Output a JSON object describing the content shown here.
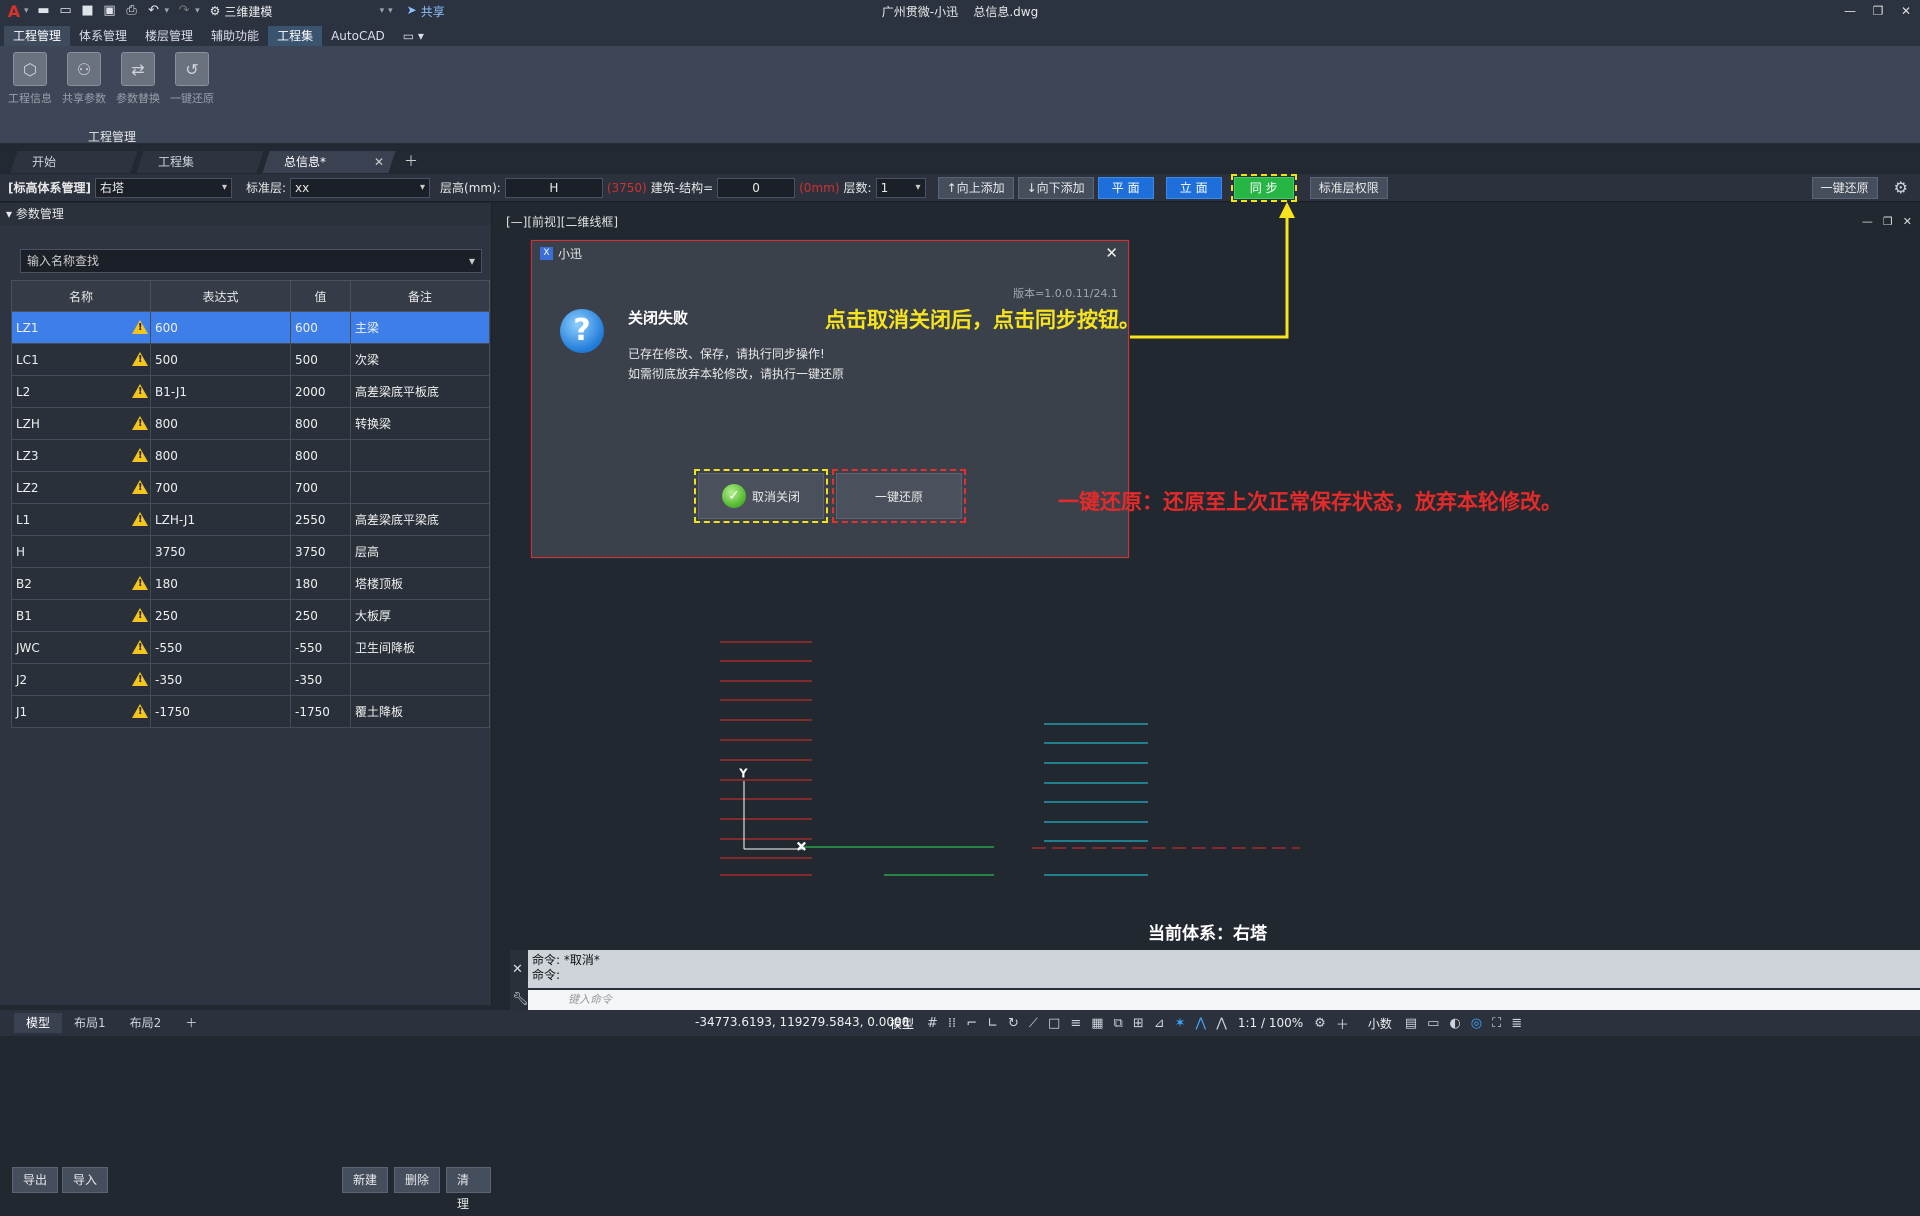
{
  "titlebar": {
    "workspace": "三维建模",
    "share": "共享",
    "app_name": "广州贯微-小迅",
    "file_name": "总信息.dwg"
  },
  "ribbon_tabs": [
    "工程管理",
    "体系管理",
    "楼层管理",
    "辅助功能",
    "工程集",
    "AutoCAD"
  ],
  "ribbon": {
    "buttons": [
      "工程信息",
      "共享参数",
      "参数替换",
      "一键还原"
    ],
    "panel_label": "工程管理"
  },
  "doc_tabs": [
    "开始",
    "工程集",
    "总信息*"
  ],
  "toolbar": {
    "system_label": "[标高体系管理]",
    "system_value": "右塔",
    "std_floor_label": "标准层:",
    "std_floor_value": "xx",
    "height_label": "层高(mm):",
    "height_value": "H",
    "height_red": "(3750)",
    "arch_label": "建筑-结构=",
    "arch_value": "0",
    "arch_red": "(0mm)",
    "floors_label": "层数:",
    "floors_value": "1",
    "add_up": "↑向上添加",
    "add_down": "↓向下添加",
    "plan": "平  面",
    "elev": "立  面",
    "sync": "同  步",
    "perm": "标准层权限",
    "restore": "一键还原"
  },
  "left_panel": {
    "title": "参数管理",
    "search_placeholder": "输入名称查找",
    "columns": [
      "名称",
      "表达式",
      "值",
      "备注"
    ],
    "rows": [
      {
        "name": "LZ1",
        "expr": "600",
        "value": "600",
        "note": "主梁",
        "warn": true,
        "selected": true
      },
      {
        "name": "LC1",
        "expr": "500",
        "value": "500",
        "note": "次梁",
        "warn": true
      },
      {
        "name": "L2",
        "expr": "B1-J1",
        "value": "2000",
        "note": "高差梁底平板底",
        "warn": true
      },
      {
        "name": "LZH",
        "expr": "800",
        "value": "800",
        "note": "转换梁",
        "warn": true
      },
      {
        "name": "LZ3",
        "expr": "800",
        "value": "800",
        "note": "",
        "warn": true
      },
      {
        "name": "LZ2",
        "expr": "700",
        "value": "700",
        "note": "",
        "warn": true
      },
      {
        "name": "L1",
        "expr": "LZH-J1",
        "value": "2550",
        "note": "高差梁底平梁底",
        "warn": true
      },
      {
        "name": "H",
        "expr": "3750",
        "value": "3750",
        "note": "层高",
        "warn": false
      },
      {
        "name": "B2",
        "expr": "180",
        "value": "180",
        "note": "塔楼顶板",
        "warn": true
      },
      {
        "name": "B1",
        "expr": "250",
        "value": "250",
        "note": "大板厚",
        "warn": true
      },
      {
        "name": "JWC",
        "expr": "-550",
        "value": "-550",
        "note": "卫生间降板",
        "warn": true
      },
      {
        "name": "J2",
        "expr": "-350",
        "value": "-350",
        "note": "",
        "warn": true
      },
      {
        "name": "J1",
        "expr": "-1750",
        "value": "-1750",
        "note": "覆土降板",
        "warn": true
      }
    ],
    "buttons": {
      "export": "导出",
      "import": "导入",
      "new": "新建",
      "delete": "删除",
      "clear": "清理"
    }
  },
  "viewport": {
    "label": "[—][前视][二维线框]",
    "current_system": "当前体系：右塔"
  },
  "dialog": {
    "title": "小迅",
    "version": "版本=1.0.0.11/24.1",
    "heading": "关闭失败",
    "line1": "已存在修改、保存，请执行同步操作!",
    "line2": "如需彻底放弃本轮修改，请执行一键还原",
    "cancel_close": "取消关闭",
    "restore": "一键还原"
  },
  "annotations": {
    "yellow": "点击取消关闭后，点击同步按钮。",
    "red": "一键还原：还原至上次正常保存状态，放弃本轮修改。"
  },
  "command": {
    "line1": "命令: *取消*",
    "line2": "命令:",
    "input_placeholder": "键入命令"
  },
  "status": {
    "tabs": [
      "模型",
      "布局1",
      "布局2"
    ],
    "coords": "-34773.6193, 119279.5843, 0.0000",
    "model": "模型",
    "scale": "1:1 / 100%",
    "units": "小数"
  },
  "colors": {
    "accent_blue": "#1e6fd9",
    "sync_green": "#27b545",
    "annot_yellow": "#f7e41d",
    "annot_red": "#e52a2a",
    "warning": "#f4c51f"
  }
}
